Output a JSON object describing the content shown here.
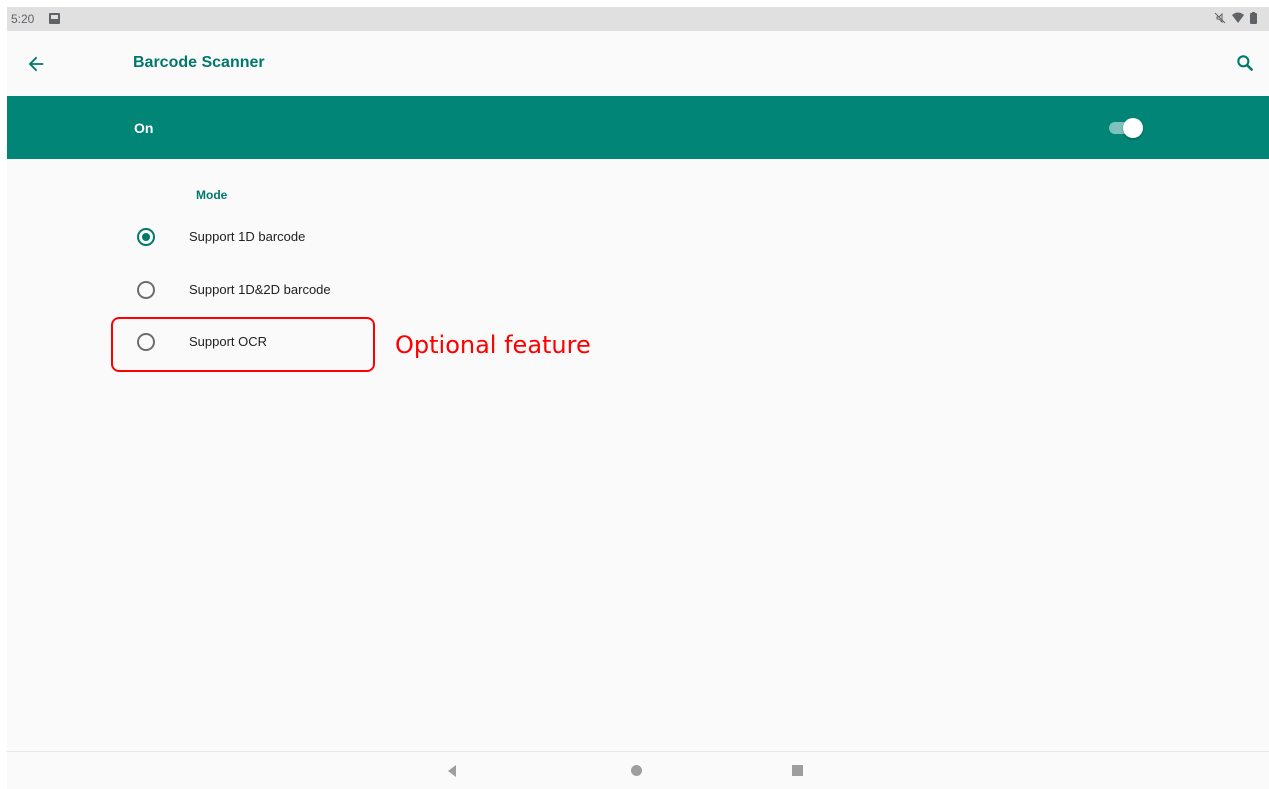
{
  "status_bar": {
    "time": "5:20",
    "icons": [
      "image-notification-icon",
      "mute-icon",
      "wifi-icon",
      "battery-icon"
    ]
  },
  "app_bar": {
    "title": "Barcode Scanner",
    "back_icon": "arrow-back-icon",
    "search_icon": "search-icon"
  },
  "master_switch": {
    "label": "On",
    "checked": true
  },
  "mode": {
    "header": "Mode",
    "options": [
      {
        "label": "Support 1D barcode",
        "selected": true
      },
      {
        "label": "Support 1D&2D barcode",
        "selected": false
      },
      {
        "label": "Support OCR",
        "selected": false
      }
    ]
  },
  "annotation": {
    "text": "Optional feature"
  },
  "nav_bar": {
    "icons": [
      "nav-back-icon",
      "nav-home-icon",
      "nav-recents-icon"
    ]
  },
  "colors": {
    "accent": "#00796b",
    "master_bar": "#008577",
    "annotation": "#ff0000",
    "background": "#fafafa"
  }
}
